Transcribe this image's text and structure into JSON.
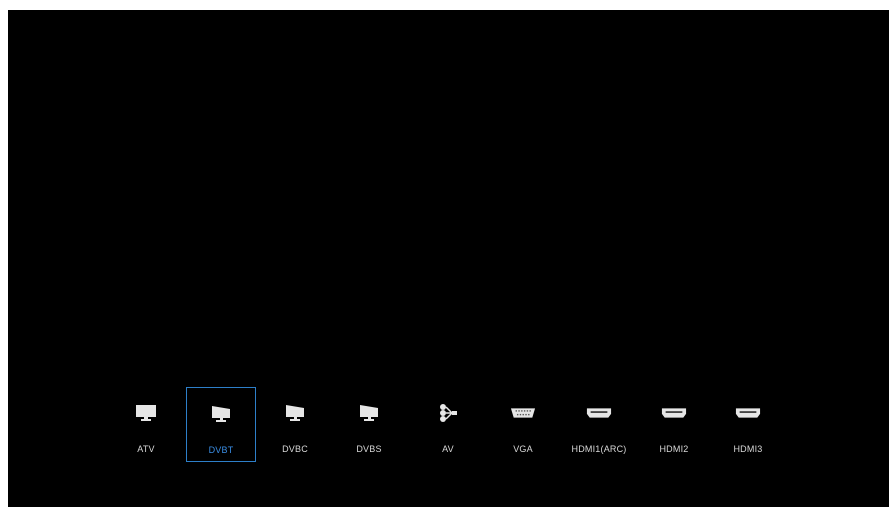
{
  "sources": {
    "selected_index": 1,
    "accent_color": "#3a8ee6",
    "items": [
      {
        "label": "ATV",
        "icon": "tv-monitor-icon"
      },
      {
        "label": "DVBT",
        "icon": "tv-monitor-angled-icon"
      },
      {
        "label": "DVBC",
        "icon": "tv-monitor-angled-icon"
      },
      {
        "label": "DVBS",
        "icon": "tv-monitor-angled-icon"
      },
      {
        "label": "AV",
        "icon": "rca-connector-icon"
      },
      {
        "label": "VGA",
        "icon": "vga-port-icon"
      },
      {
        "label": "HDMI1(ARC)",
        "icon": "hdmi-port-icon"
      },
      {
        "label": "HDMI2",
        "icon": "hdmi-port-icon"
      },
      {
        "label": "HDMI3",
        "icon": "hdmi-port-icon"
      }
    ]
  }
}
